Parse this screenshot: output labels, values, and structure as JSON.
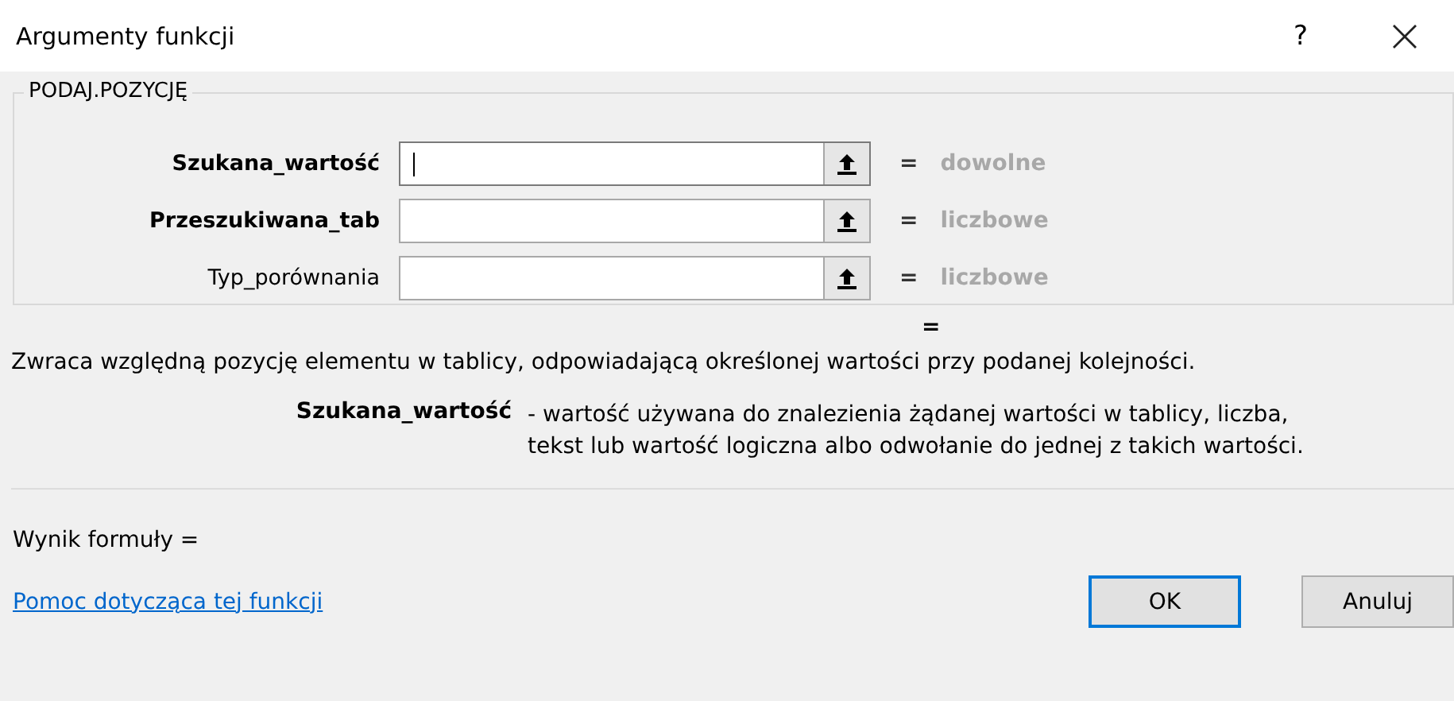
{
  "window": {
    "title": "Argumenty funkcji",
    "help": "?"
  },
  "group": {
    "title": "PODAJ.POZYCJĘ",
    "arguments": [
      {
        "label": "Szukana_wartość",
        "required": true,
        "focused": true,
        "result": "dowolne"
      },
      {
        "label": "Przeszukiwana_tab",
        "required": true,
        "focused": false,
        "result": "liczbowe"
      },
      {
        "label": "Typ_porównania",
        "required": false,
        "focused": false,
        "result": "liczbowe"
      }
    ],
    "equals": "="
  },
  "function_result": "=",
  "description": "Zwraca względną pozycję elementu w tablicy, odpowiadającą określonej wartości przy podanej kolejności.",
  "argument_help": {
    "name": "Szukana_wartość",
    "text": "- wartość używana do znalezienia żądanej wartości w tablicy, liczba, tekst lub wartość logiczna albo odwołanie do jednej z takich wartości."
  },
  "formula_result": "Wynik formuły =",
  "help_link": "Pomoc dotycząca tej funkcji",
  "buttons": [
    {
      "label": "OK",
      "default": true
    },
    {
      "label": "Anuluj",
      "default": false
    }
  ]
}
